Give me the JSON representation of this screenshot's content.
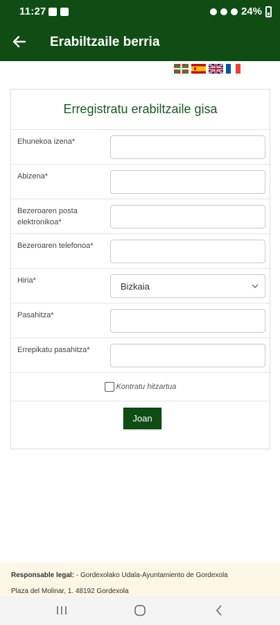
{
  "status_bar": {
    "time": "11:27",
    "battery": "24%"
  },
  "app_bar": {
    "title": "Erabiltzaile berria",
    "back_icon": "arrow-left-icon"
  },
  "languages": [
    "Euskara",
    "Español",
    "English",
    "Français"
  ],
  "form": {
    "title": "Erregistratu erabiltzaile gisa",
    "fields": [
      {
        "label": "Ehunekoa izena*",
        "value": ""
      },
      {
        "label": "Abizena*",
        "value": ""
      },
      {
        "label": "Bezeroaren posta elektronikoa*",
        "value": ""
      },
      {
        "label": "Bezeroaren telefonoa*",
        "value": ""
      },
      {
        "label": "Hiria*",
        "value": "Bizkaia"
      },
      {
        "label": "Pasahitza*",
        "value": ""
      },
      {
        "label": "Errepikatu pasahitza*",
        "value": ""
      }
    ],
    "terms_label": "Kontratu hitzartua",
    "terms_checked": false,
    "submit_label": "Joan"
  },
  "footer": {
    "legal_label": "Responsable legal:",
    "legal_text": " - Gordexolako Udala-Ayuntamiento de Gordexola",
    "address": "Plaza del Molinar, 1. 48192 Gordexola"
  },
  "colors": {
    "primary": "#0f4d14",
    "footer_bg": "#fbf7e4"
  }
}
